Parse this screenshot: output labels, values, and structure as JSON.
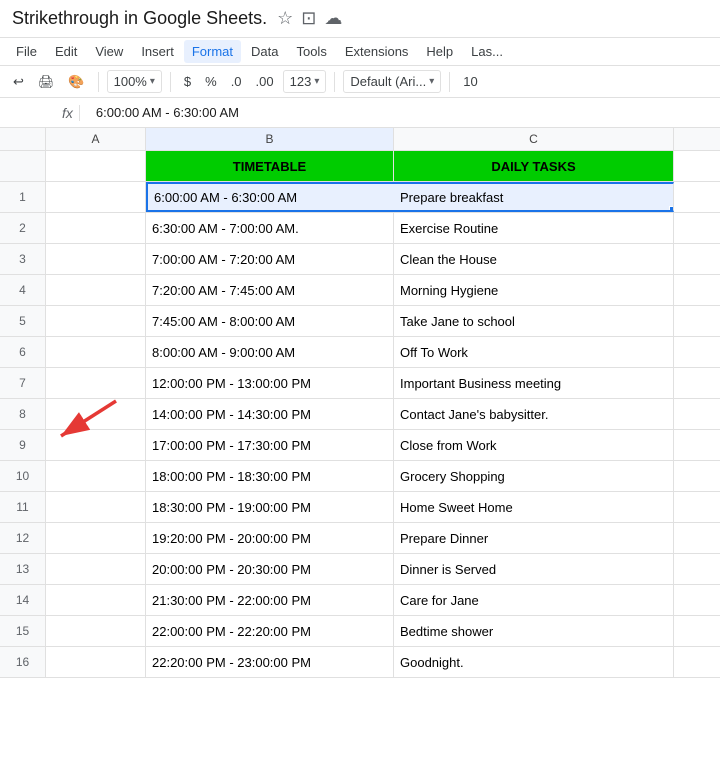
{
  "title": {
    "text": "Strikethrough in Google Sheets.",
    "icons": [
      "star",
      "folder",
      "cloud"
    ]
  },
  "menu": {
    "items": [
      "File",
      "Edit",
      "View",
      "Insert",
      "Format",
      "Data",
      "Tools",
      "Extensions",
      "Help",
      "Las..."
    ]
  },
  "toolbar": {
    "zoom": "100%",
    "currency": "$",
    "percent": "%",
    "decimal0": ".0",
    "decimal00": ".00",
    "number_format": "123",
    "font": "Default (Ari...",
    "font_size": "10"
  },
  "formula_bar": {
    "cell_ref": "",
    "fx_label": "fx",
    "content": "6:00:00 AM - 6:30:00 AM"
  },
  "columns": {
    "a_header": "A",
    "b_header": "B",
    "c_header": "C"
  },
  "sheet": {
    "header_b": "TIMETABLE",
    "header_c": "DAILY TASKS",
    "rows": [
      {
        "num": "1",
        "b": "6:00:00 AM - 6:30:00 AM",
        "c": "Prepare breakfast",
        "selected": true
      },
      {
        "num": "2",
        "b": "6:30:00 AM - 7:00:00 AM.",
        "c": "Exercise Routine",
        "selected": false
      },
      {
        "num": "3",
        "b": "7:00:00 AM - 7:20:00 AM",
        "c": "Clean the House",
        "selected": false
      },
      {
        "num": "4",
        "b": "7:20:00 AM - 7:45:00 AM",
        "c": "Morning Hygiene",
        "selected": false
      },
      {
        "num": "5",
        "b": "7:45:00 AM - 8:00:00 AM",
        "c": "Take Jane to school",
        "selected": false
      },
      {
        "num": "6",
        "b": "8:00:00 AM - 9:00:00 AM",
        "c": "Off To Work",
        "selected": false
      },
      {
        "num": "7",
        "b": "12:00:00 PM - 13:00:00 PM",
        "c": "Important Business meeting",
        "selected": false
      },
      {
        "num": "8",
        "b": "14:00:00 PM - 14:30:00 PM",
        "c": "Contact Jane's babysitter.",
        "selected": false
      },
      {
        "num": "9",
        "b": "17:00:00 PM - 17:30:00 PM",
        "c": "Close from Work",
        "selected": false
      },
      {
        "num": "10",
        "b": "18:00:00 PM - 18:30:00 PM",
        "c": "Grocery Shopping",
        "selected": false
      },
      {
        "num": "11",
        "b": "18:30:00 PM - 19:00:00 PM",
        "c": "Home Sweet Home",
        "selected": false
      },
      {
        "num": "12",
        "b": "19:20:00 PM - 20:00:00 PM",
        "c": "Prepare Dinner",
        "selected": false
      },
      {
        "num": "13",
        "b": "20:00:00 PM - 20:30:00 PM",
        "c": "Dinner is Served",
        "selected": false
      },
      {
        "num": "14",
        "b": "21:30:00 PM - 22:00:00 PM",
        "c": "Care for Jane",
        "selected": false
      },
      {
        "num": "15",
        "b": "22:00:00 PM - 22:20:00 PM",
        "c": "Bedtime shower",
        "selected": false
      },
      {
        "num": "16",
        "b": "22:20:00 PM - 23:00:00 PM",
        "c": "Goodnight.",
        "selected": false
      }
    ]
  }
}
